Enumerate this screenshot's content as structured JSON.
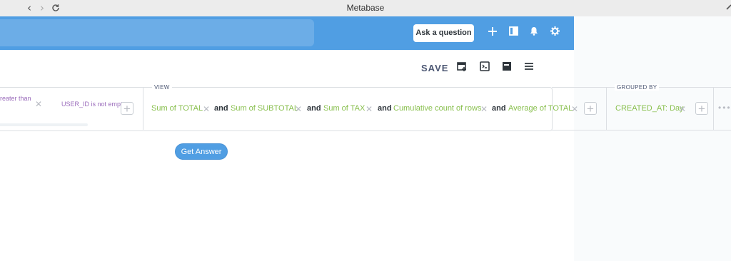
{
  "window": {
    "title": "Metabase"
  },
  "header": {
    "ask_button": "Ask a question"
  },
  "toolbar": {
    "save_label": "SAVE"
  },
  "filters": [
    {
      "label": "reater than"
    },
    {
      "label": "USER_ID is not empt"
    }
  ],
  "view": {
    "section_label": "VIEW",
    "metrics": [
      "Sum of TOTAL",
      "Sum of SUBTOTAL",
      "Sum of TAX",
      "Cumulative count of rows",
      "Average of TOTAL"
    ],
    "joiner": "and"
  },
  "grouped_by": {
    "section_label": "GROUPED BY",
    "items": [
      "CREATED_AT: Day"
    ]
  },
  "get_answer_label": "Get Answer",
  "colors": {
    "brand": "#509ee3",
    "metric": "#88bf4d",
    "filter": "#9a6bbb"
  }
}
